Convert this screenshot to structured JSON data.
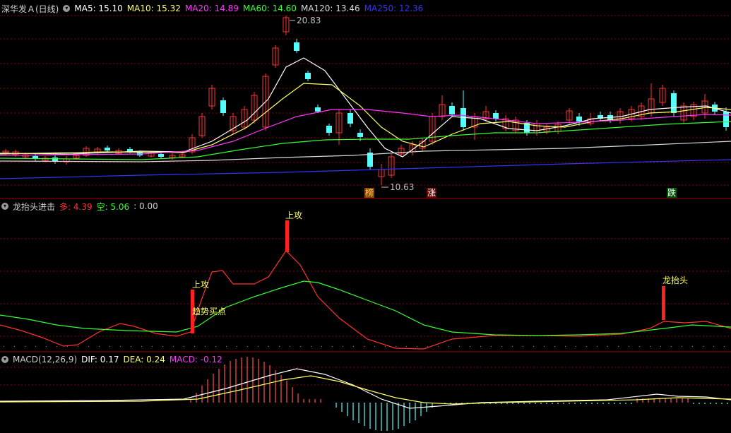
{
  "main": {
    "title": "深华发Ａ(日线)",
    "ma": [
      {
        "label": "MA5: 15.10",
        "color": "#ffffff"
      },
      {
        "label": "MA10: 15.32",
        "color": "#ffff66"
      },
      {
        "label": "MA20: 14.89",
        "color": "#ff33ff"
      },
      {
        "label": "MA60: 14.60",
        "color": "#33ff33"
      },
      {
        "label": "MA120: 13.46",
        "color": "#d8d8d8"
      },
      {
        "label": "MA250: 12.36",
        "color": "#3333ff"
      }
    ],
    "high_label": "20.83",
    "low_label": "10.63",
    "signals": [
      "榜",
      "涨",
      "跌"
    ]
  },
  "indicator": {
    "title": "龙抬头进击",
    "duo": "多: 4.39",
    "kong": "空: 5.06",
    "extra": ": 0.00",
    "labels": {
      "shanggong1": "上攻",
      "shanggong2": "上攻",
      "qushi": "趋势买点",
      "longtaitou": "龙抬头"
    }
  },
  "macd": {
    "title": "MACD(12,26,9)",
    "dif": "DIF: 0.17",
    "dea": "DEA: 0.24",
    "macd": "MACD: -0.12"
  },
  "colors": {
    "up": "#ff3232",
    "down": "#54fcfc",
    "grid": "#8b0000"
  }
}
